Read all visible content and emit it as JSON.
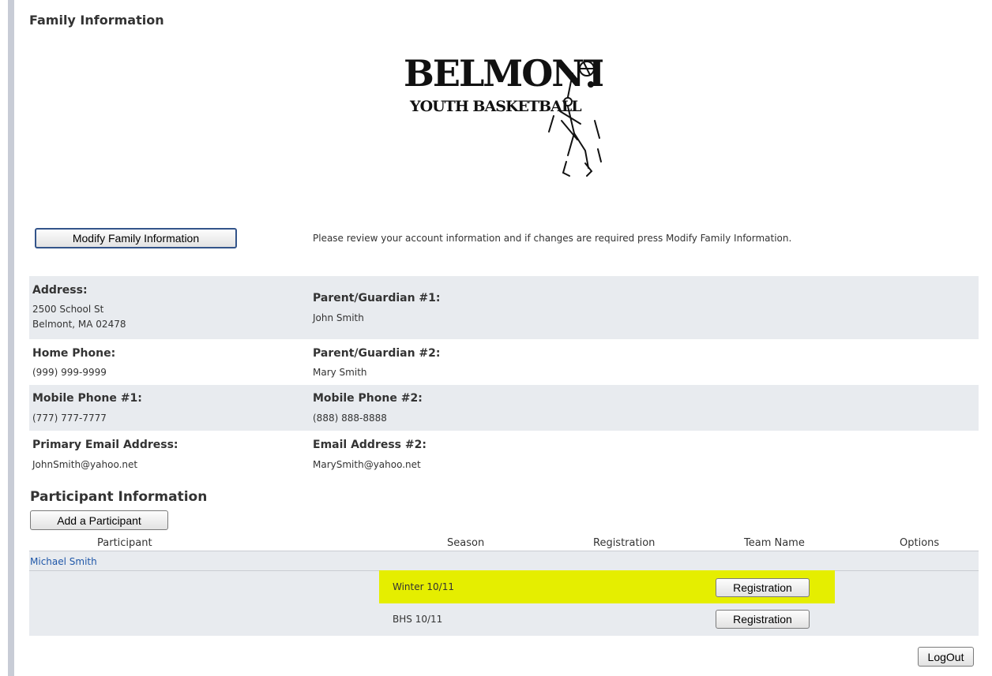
{
  "family": {
    "title": "Family Information",
    "logo_text_line1": "BELMONT",
    "logo_text_line2": "YOUTH BASKETBALL",
    "modify_button": "Modify Family Information",
    "review_text": "Please review your account information and if changes are required press Modify Family Information."
  },
  "fields": {
    "address_label": "Address:",
    "address_line1": "2500 School St",
    "address_line2": "Belmont, MA 02478",
    "parent1_label": "Parent/Guardian #1:",
    "parent1_value": "John Smith",
    "home_phone_label": "Home Phone:",
    "home_phone_value": "(999) 999-9999",
    "parent2_label": "Parent/Guardian #2:",
    "parent2_value": "Mary Smith",
    "mobile1_label": "Mobile Phone #1:",
    "mobile1_value": "(777) 777-7777",
    "mobile2_label": "Mobile Phone #2:",
    "mobile2_value": "(888) 888-8888",
    "email1_label": "Primary Email Address:",
    "email1_value": "JohnSmith@yahoo.net",
    "email2_label": "Email Address #2:",
    "email2_value": "MarySmith@yahoo.net"
  },
  "participants": {
    "title": "Participant Information",
    "add_button": "Add a Participant",
    "columns": [
      "Participant",
      "Season",
      "Registration",
      "Team Name",
      "Options"
    ],
    "rows": [
      {
        "name": "Michael Smith",
        "seasons": [
          {
            "season": "Winter 10/11",
            "button": "Registration",
            "highlighted": true
          },
          {
            "season": "BHS 10/11",
            "button": "Registration",
            "highlighted": false
          }
        ]
      }
    ]
  },
  "logout_button": "LogOut",
  "colors": {
    "highlight": "#e5ee00",
    "row_shade": "#e8ebef",
    "link": "#1f57a8"
  }
}
